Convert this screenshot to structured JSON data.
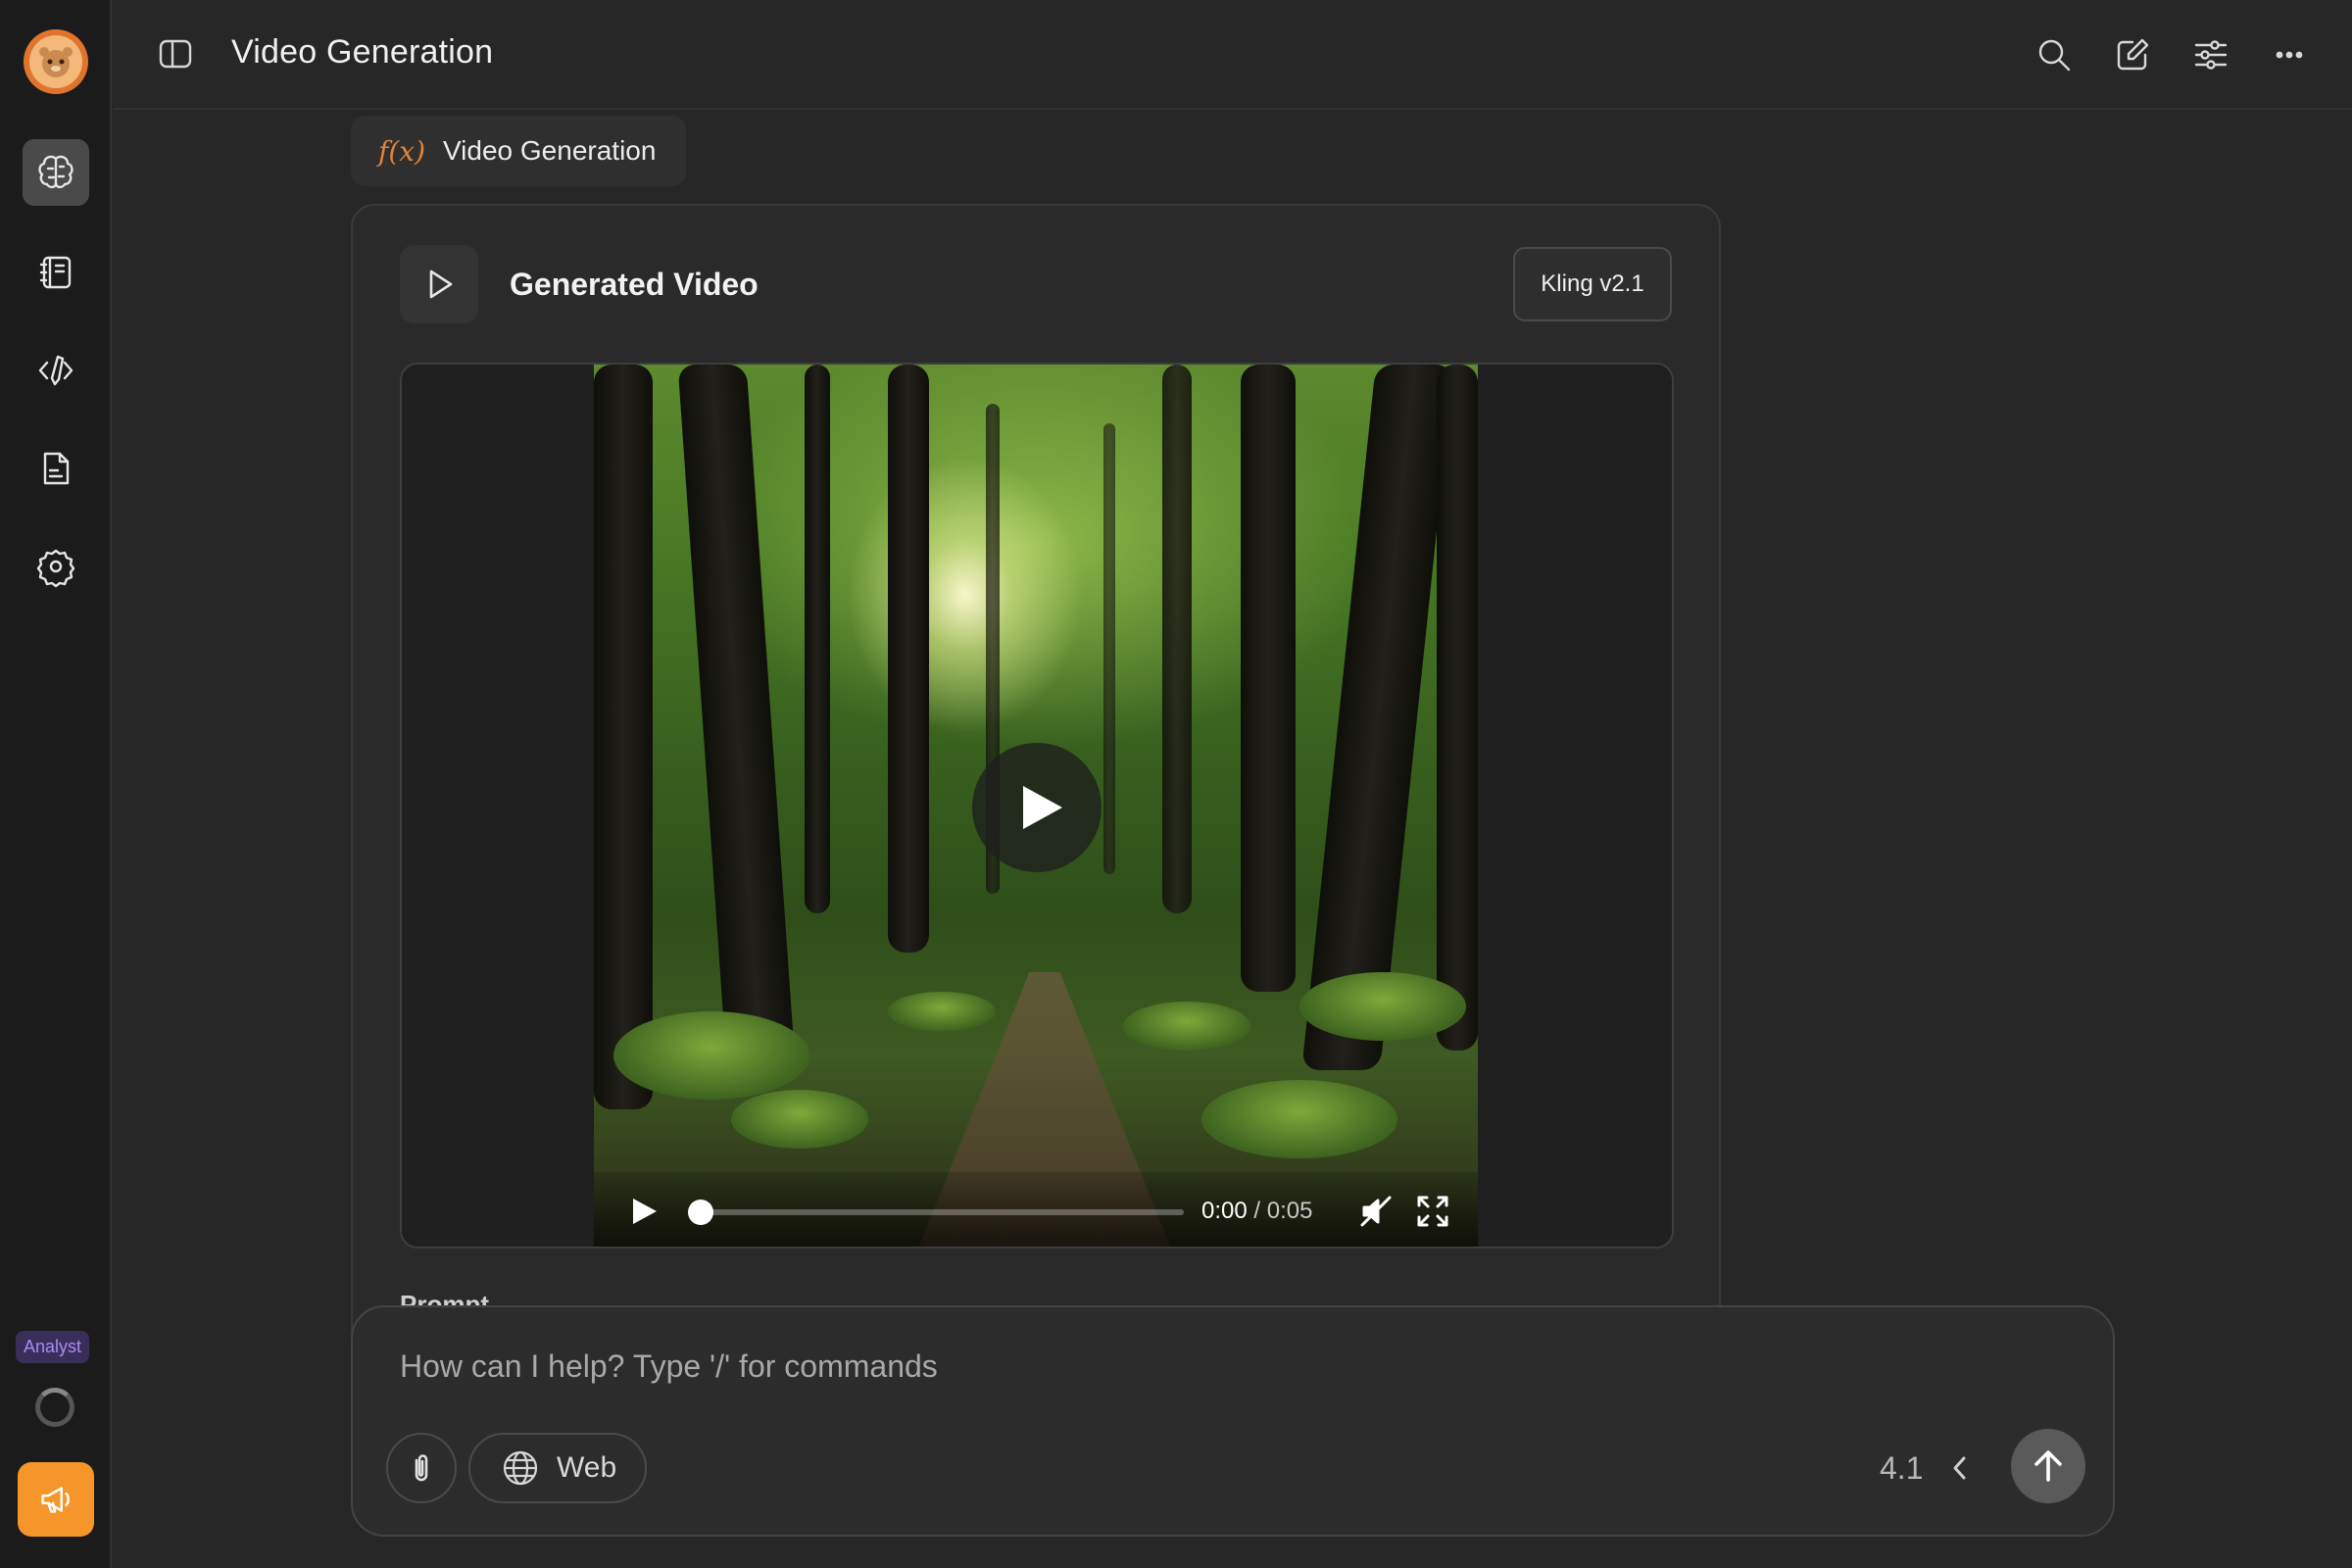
{
  "header": {
    "title": "Video Generation",
    "icons": [
      "search-icon",
      "edit-icon",
      "sliders-icon",
      "more-icon"
    ]
  },
  "rail": {
    "items": [
      "brain-icon",
      "notebook-icon",
      "code-pen-icon",
      "document-icon",
      "settings-icon"
    ],
    "badge": "Analyst",
    "accent": "#f6962a"
  },
  "tool_call": {
    "symbol": "f(x)",
    "label": "Video Generation"
  },
  "video_card": {
    "title": "Generated Video",
    "model": "Kling v2.1",
    "player": {
      "current_time": "0:00",
      "separator": " / ",
      "duration": "0:05",
      "progress": 0,
      "muted": true
    },
    "prompt_heading": "Prompt"
  },
  "composer": {
    "placeholder": "How can I help? Type '/' for commands",
    "web_label": "Web",
    "model_version": "4.1"
  }
}
